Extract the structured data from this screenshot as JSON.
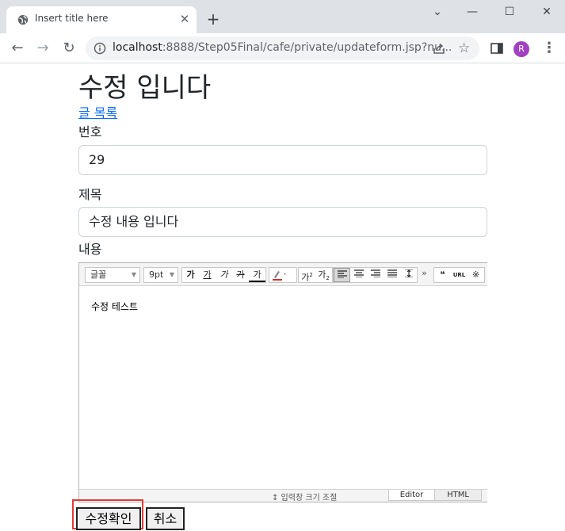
{
  "browser": {
    "tab_title": "Insert title here",
    "url_host": "localhost",
    "url_path": ":8888/Step05Final/cafe/private/updateform.jsp?nu...",
    "profile_initial": "R"
  },
  "page": {
    "title": "수정 입니다",
    "list_link": "글 목록",
    "number_label": "번호",
    "number_value": "29",
    "title_label": "제목",
    "title_value": "수정 내용 입니다",
    "content_label": "내용"
  },
  "editor": {
    "font_select": "글꼴",
    "size_select": "9pt",
    "format_buttons": [
      "가",
      "가",
      "가",
      "가",
      "가"
    ],
    "superscript": "가",
    "subscript": "가",
    "quote_button": "66",
    "url_button": "URL",
    "special_button": "※",
    "more_button": "»",
    "body_text": "수정 테스트",
    "resize_label": "↕ 입력창 크기 조절",
    "mode_editor": "Editor",
    "mode_html": "HTML"
  },
  "buttons": {
    "submit": "수정확인",
    "cancel": "취소"
  },
  "colors": {
    "link": "#0d6efd",
    "highlight": "#e53935",
    "avatar": "#a142c2"
  }
}
